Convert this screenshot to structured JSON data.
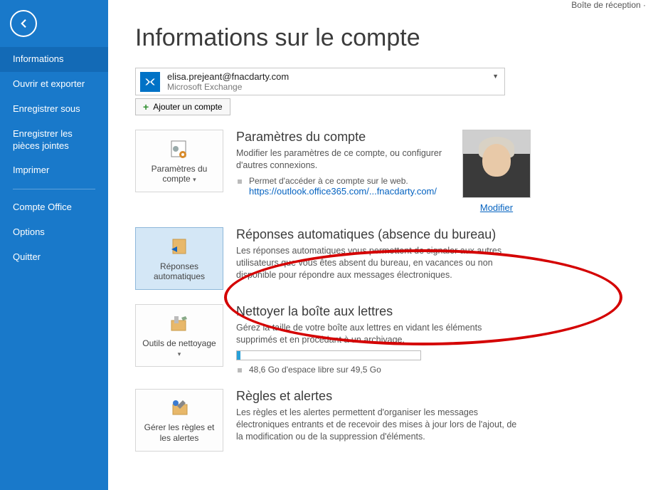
{
  "topright": "Boîte de réception ·",
  "sidebar": {
    "items": [
      {
        "label": "Informations",
        "active": true
      },
      {
        "label": "Ouvrir et exporter"
      },
      {
        "label": "Enregistrer sous"
      },
      {
        "label": "Enregistrer les pièces jointes"
      },
      {
        "label": "Imprimer"
      }
    ],
    "items2": [
      {
        "label": "Compte Office"
      },
      {
        "label": "Options"
      },
      {
        "label": "Quitter"
      }
    ]
  },
  "page_title": "Informations sur le compte",
  "account": {
    "email": "elisa.prejeant@fnacdarty.com",
    "type": "Microsoft Exchange",
    "add_label": "Ajouter un compte"
  },
  "sections": {
    "settings": {
      "tile": "Paramètres du compte",
      "title": "Paramètres du compte",
      "body": "Modifier les paramètres de ce compte, ou configurer d'autres connexions.",
      "sub": "Permet d'accéder à ce compte sur le web.",
      "link": "https://outlook.office365.com/...fnacdarty.com/",
      "avatar_link": "Modifier"
    },
    "auto": {
      "tile": "Réponses automatiques",
      "title": "Réponses automatiques (absence du bureau)",
      "body": "Les réponses automatiques vous permettent de signaler aux autres utilisateurs que vous êtes absent du bureau, en vacances ou non disponible pour répondre aux messages électroniques."
    },
    "clean": {
      "tile": "Outils de nettoyage",
      "title": "Nettoyer la boîte aux lettres",
      "body": "Gérez la taille de votre boîte aux lettres en vidant les éléments supprimés et en procédant à un archivage.",
      "storage": "48,6 Go d'espace libre sur 49,5 Go"
    },
    "rules": {
      "tile": "Gérer les règles et les alertes",
      "title": "Règles et alertes",
      "body": "Les règles et les alertes permettent d'organiser les messages électroniques entrants et de recevoir des mises à jour lors de l'ajout, de la modification ou de la suppression d'éléments."
    }
  }
}
